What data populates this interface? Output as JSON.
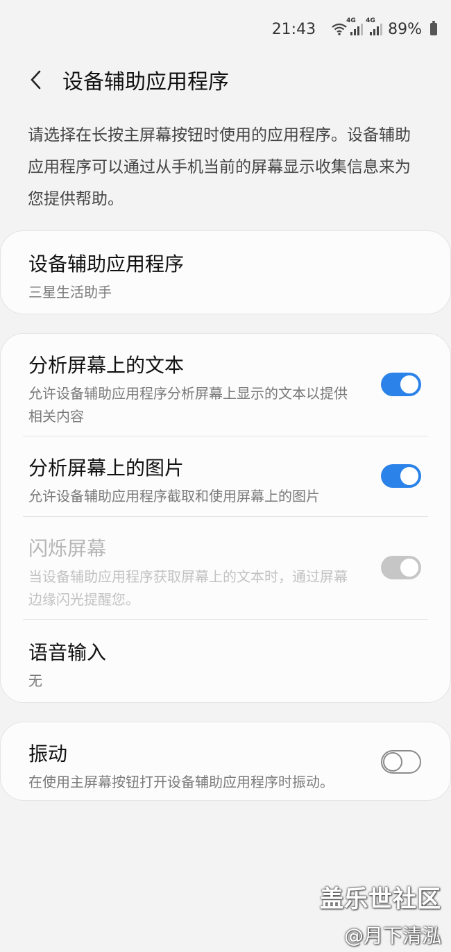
{
  "status_bar": {
    "time": "21:43",
    "network_label_1": "4G",
    "network_label_2": "4G",
    "battery": "89%"
  },
  "header": {
    "title": "设备辅助应用程序"
  },
  "description": "请选择在长按主屏幕按钮时使用的应用程序。设备辅助应用程序可以通过从手机当前的屏幕显示收集信息来为您提供帮助。",
  "cards": {
    "assist_app": {
      "title": "设备辅助应用程序",
      "value": "三星生活助手"
    },
    "analyze_text": {
      "title": "分析屏幕上的文本",
      "subtitle": "允许设备辅助应用程序分析屏幕上显示的文本以提供相关内容",
      "enabled": true
    },
    "analyze_images": {
      "title": "分析屏幕上的图片",
      "subtitle": "允许设备辅助应用程序截取和使用屏幕上的图片",
      "enabled": true
    },
    "flash_screen": {
      "title": "闪烁屏幕",
      "subtitle": "当设备辅助应用程序获取屏幕上的文本时，通过屏幕边缘闪光提醒您。",
      "enabled": true,
      "disabled": true
    },
    "voice_input": {
      "title": "语音输入",
      "value": "无"
    },
    "vibration": {
      "title": "振动",
      "subtitle": "在使用主屏幕按钮打开设备辅助应用程序时振动。",
      "enabled": false
    }
  },
  "watermark": {
    "line1": "盖乐世社区",
    "line2": "@月下清泓"
  },
  "colors": {
    "accent": "#2b82e8",
    "background": "#f3f3f3",
    "card": "#fcfcfc"
  }
}
